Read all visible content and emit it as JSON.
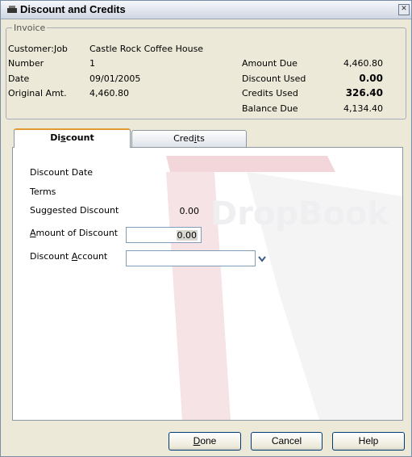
{
  "window": {
    "title": "Discount and Credits"
  },
  "invoice": {
    "legend": "Invoice",
    "customer_job_label": "Customer:Job",
    "customer_job_value": "Castle Rock Coffee House",
    "number_label": "Number",
    "number_value": "1",
    "date_label": "Date",
    "date_value": "09/01/2005",
    "original_amt_label": "Original Amt.",
    "original_amt_value": "4,460.80",
    "amount_due_label": "Amount Due",
    "amount_due_value": "4,460.80",
    "discount_used_label": "Discount Used",
    "discount_used_value": "0.00",
    "credits_used_label": "Credits Used",
    "credits_used_value": "326.40",
    "balance_due_label": "Balance Due",
    "balance_due_value": "4,134.40"
  },
  "tabs": {
    "discount": {
      "pre": "Di",
      "accel": "s",
      "post": "count"
    },
    "credits": {
      "pre": "Cred",
      "accel": "i",
      "post": "ts"
    }
  },
  "discount_panel": {
    "discount_date_label": "Discount Date",
    "terms_label": "Terms",
    "suggested_label": "Suggested Discount",
    "suggested_value": "0.00",
    "amount_label": {
      "pre": "",
      "accel": "A",
      "post": "mount of Discount"
    },
    "amount_value": "0.00",
    "account_label": {
      "pre": "Discount ",
      "accel": "A",
      "post": "ccount"
    },
    "account_value": ""
  },
  "watermark": "DropBook",
  "buttons": {
    "done": {
      "pre": "",
      "accel": "D",
      "post": "one"
    },
    "cancel": "Cancel",
    "help": "Help"
  }
}
